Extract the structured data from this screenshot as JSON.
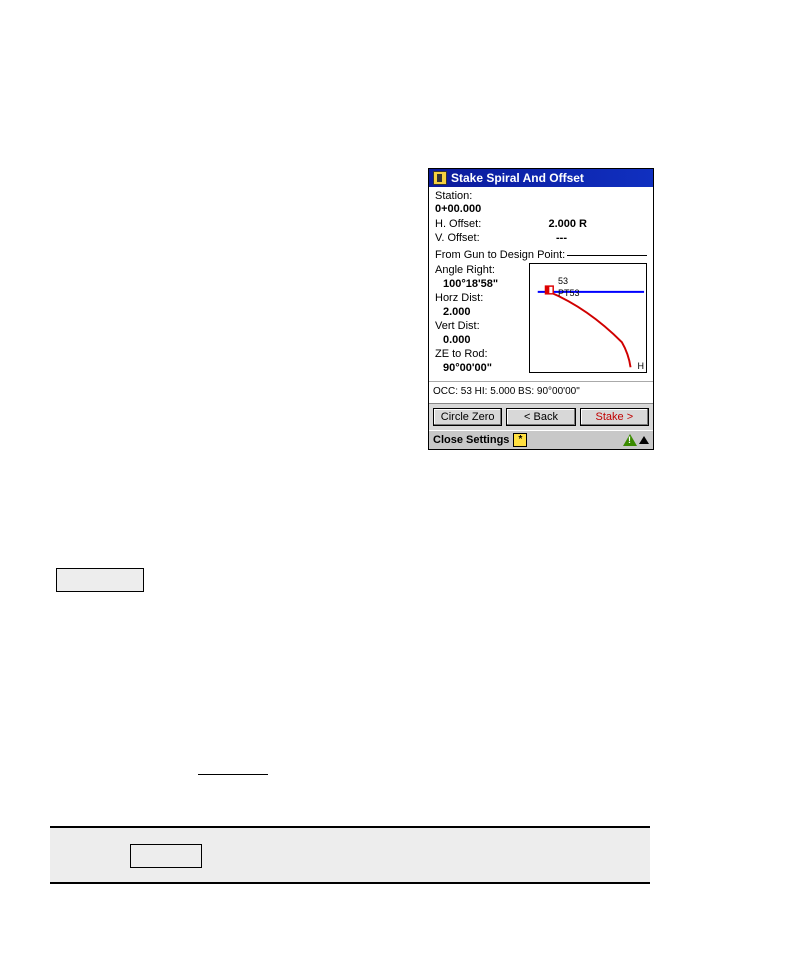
{
  "titlebar": {
    "title": "Stake Spiral And Offset"
  },
  "fields": {
    "station_label": "Station:",
    "station_value": "0+00.000",
    "h_offset_label": "H. Offset:",
    "h_offset_value": "2.000 R",
    "v_offset_label": "V. Offset:",
    "v_offset_value": "---",
    "section_label": "From Gun to Design Point:",
    "angle_right_label": "Angle Right:",
    "angle_right_value": "100°18'58\"",
    "horz_dist_label": "Horz Dist:",
    "horz_dist_value": "2.000",
    "vert_dist_label": "Vert Dist:",
    "vert_dist_value": "0.000",
    "ze_rod_label": "ZE to Rod:",
    "ze_rod_value": "90°00'00\""
  },
  "plot": {
    "pt_top": "53",
    "pt_bottom": "PT53",
    "axis_h": "H"
  },
  "status": {
    "text": "OCC: 53  HI: 5.000  BS: 90°00'00\""
  },
  "buttons": {
    "circle_zero": "Circle Zero",
    "back": "< Back",
    "stake": "Stake >"
  },
  "footer": {
    "close_settings": "Close Settings",
    "star": "*"
  }
}
